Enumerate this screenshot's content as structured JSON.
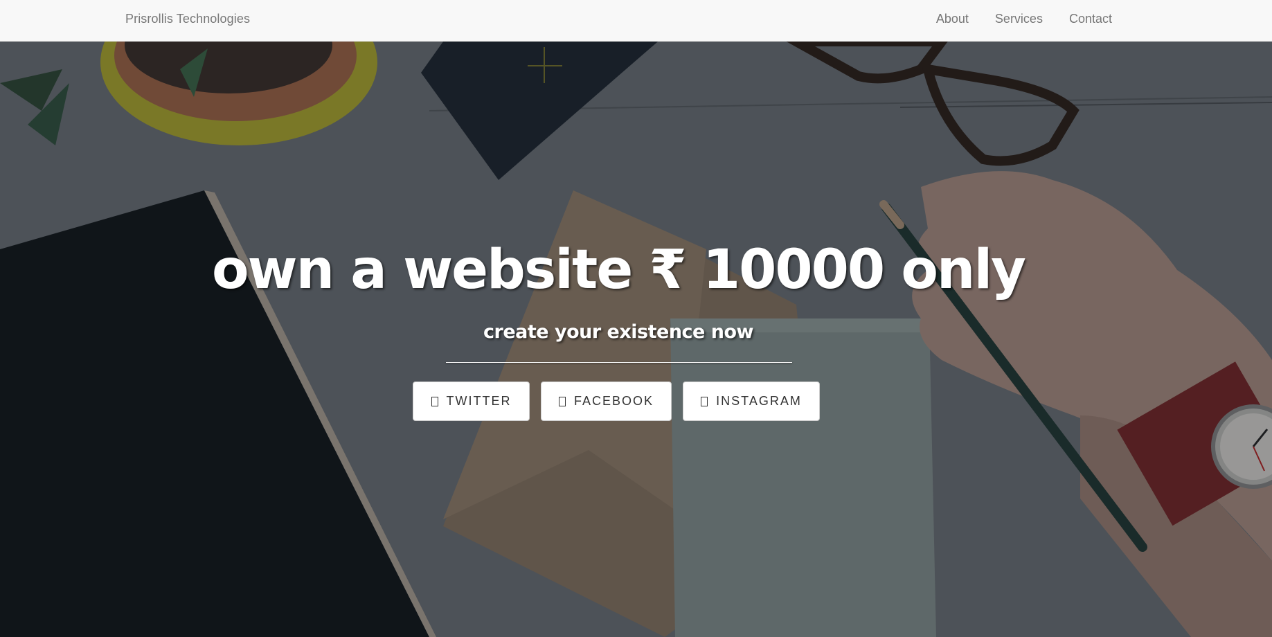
{
  "navbar": {
    "brand": "Prisrollis Technologies",
    "links": [
      {
        "label": "About"
      },
      {
        "label": "Services"
      },
      {
        "label": "Contact"
      }
    ]
  },
  "hero": {
    "headline": "own a website ₹ 10000 only",
    "subheadline": "create your existence now",
    "buttons": [
      {
        "label": "TWITTER",
        "icon": "twitter-icon"
      },
      {
        "label": "FACEBOOK",
        "icon": "facebook-icon"
      },
      {
        "label": "INSTAGRAM",
        "icon": "instagram-icon"
      }
    ]
  }
}
